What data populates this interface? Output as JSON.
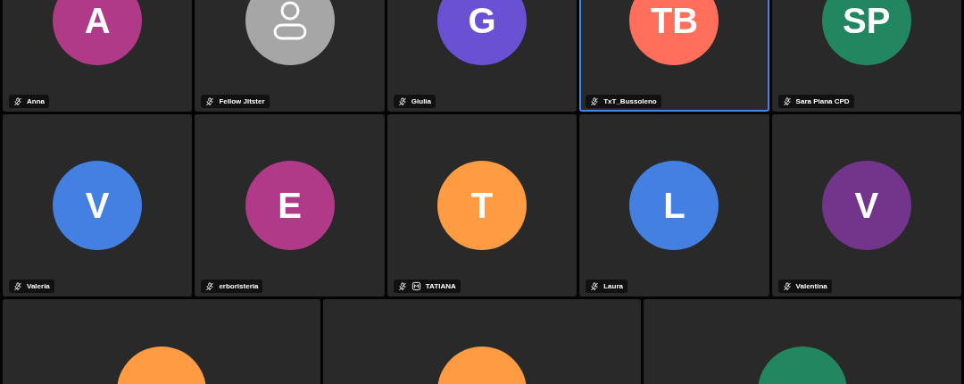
{
  "tiles": [
    {
      "kind": "initials",
      "initials": "A",
      "color": "#b03a88",
      "name": "Anna",
      "selected": false,
      "moderator": false
    },
    {
      "kind": "default",
      "color": "#a6a6a6",
      "name": "Fellow Jitster",
      "selected": false,
      "moderator": false
    },
    {
      "kind": "initials",
      "initials": "G",
      "color": "#6a50d3",
      "name": "Giulia",
      "selected": false,
      "moderator": false
    },
    {
      "kind": "initials",
      "initials": "TB",
      "color": "#ff6f5b",
      "name": "TxT_Bussoleno",
      "selected": true,
      "moderator": false
    },
    {
      "kind": "initials",
      "initials": "SP",
      "color": "#228660",
      "name": "Sara Piana CPD",
      "selected": false,
      "moderator": false
    },
    {
      "kind": "initials",
      "initials": "V",
      "color": "#4380e2",
      "name": "Valeria",
      "selected": false,
      "moderator": false
    },
    {
      "kind": "initials",
      "initials": "E",
      "color": "#b03a88",
      "name": "erboristeria",
      "selected": false,
      "moderator": false
    },
    {
      "kind": "initials",
      "initials": "T",
      "color": "#ff9b42",
      "name": "TATIANA",
      "selected": false,
      "moderator": true
    },
    {
      "kind": "initials",
      "initials": "L",
      "color": "#4380e2",
      "name": "Laura",
      "selected": false,
      "moderator": false
    },
    {
      "kind": "initials",
      "initials": "V",
      "color": "#73348c",
      "name": "Valentina",
      "selected": false,
      "moderator": false
    },
    {
      "kind": "cut",
      "color": "#ff9b42",
      "selected": false
    },
    {
      "kind": "cut",
      "color": "#ff9b42",
      "selected": false
    },
    {
      "kind": "cut",
      "color": "#228660",
      "selected": false
    }
  ]
}
